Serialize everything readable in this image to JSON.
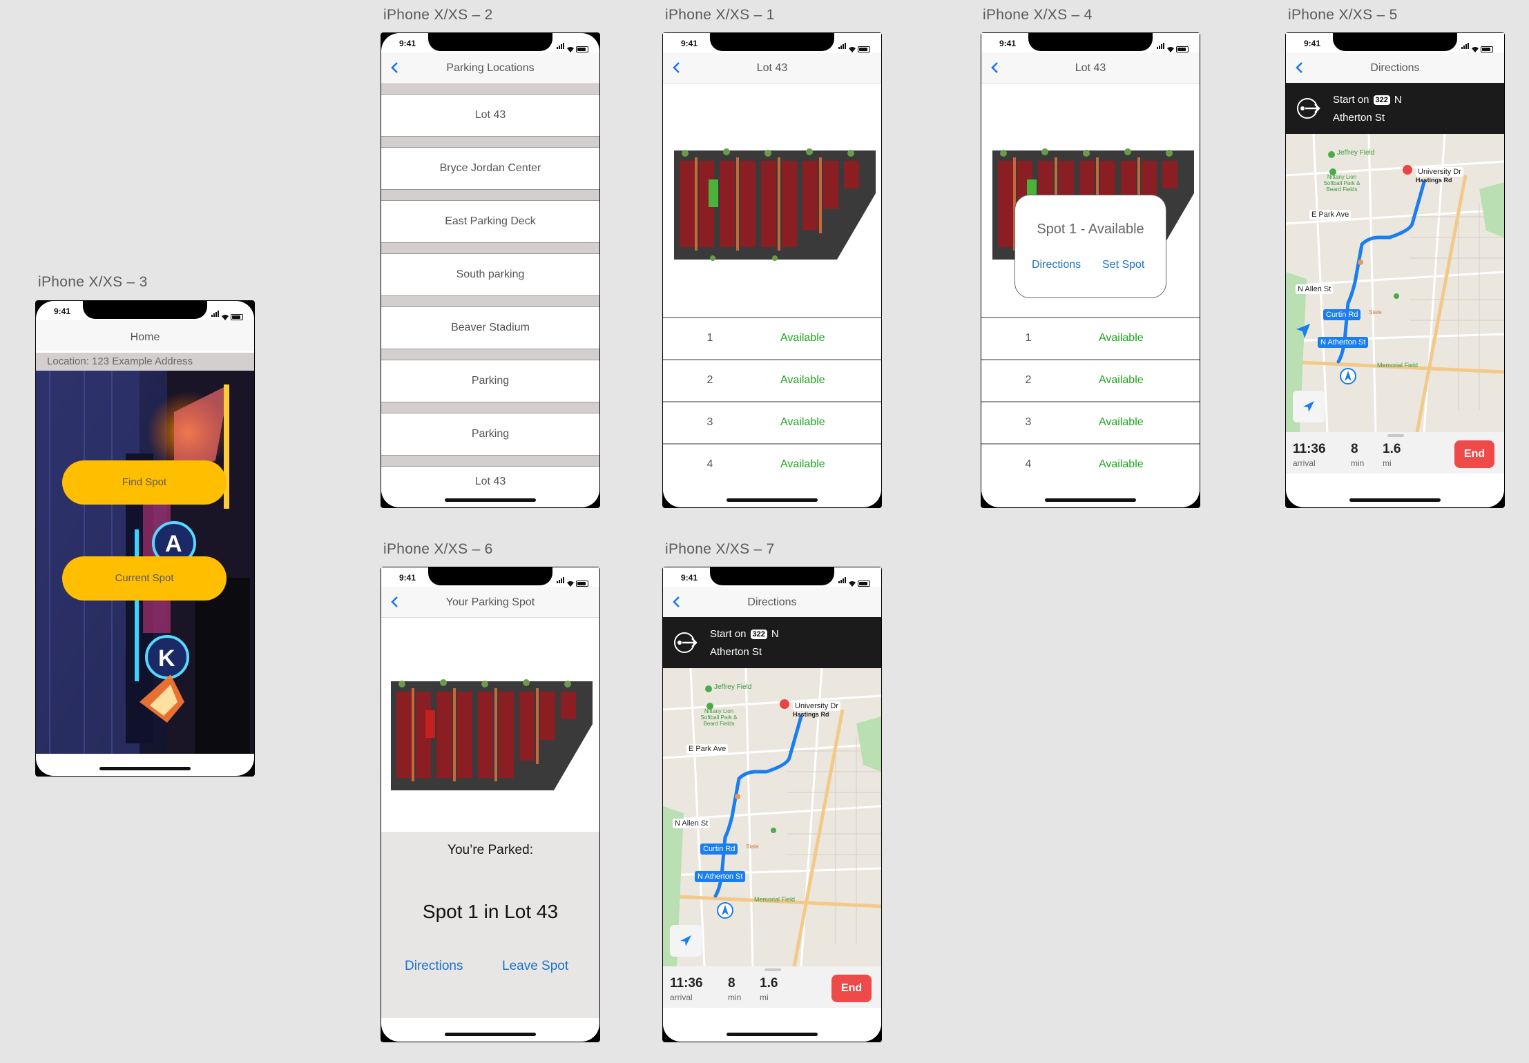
{
  "status_time": "9:41",
  "artboards": {
    "a3": "iPhone X/XS – 3",
    "a2": "iPhone X/XS – 2",
    "a1": "iPhone X/XS – 1",
    "a4": "iPhone X/XS – 4",
    "a5": "iPhone X/XS – 5",
    "a6": "iPhone X/XS – 6",
    "a7": "iPhone X/XS – 7"
  },
  "home": {
    "title": "Home",
    "location": "Location: 123 Example Address",
    "find_spot": "Find Spot",
    "current_spot": "Current Spot",
    "accent": "#ffbe00"
  },
  "parking_locations": {
    "title": "Parking Locations",
    "items": [
      "Lot 43",
      "Bryce Jordan Center",
      "East Parking Deck",
      "South parking",
      "Beaver Stadium",
      "Parking",
      "Parking",
      "Lot 43"
    ]
  },
  "lot": {
    "title": "Lot 43",
    "spots": [
      {
        "num": "1",
        "status": "Available"
      },
      {
        "num": "2",
        "status": "Available"
      },
      {
        "num": "3",
        "status": "Available"
      },
      {
        "num": "4",
        "status": "Available"
      }
    ],
    "status_color": "#19a619"
  },
  "popup": {
    "title": "Spot 1 - Available",
    "directions": "Directions",
    "set_spot": "Set Spot"
  },
  "directions": {
    "title": "Directions",
    "start_on": "Start on",
    "route": "322",
    "dir": "N",
    "street": "Atherton St",
    "arrival_val": "11:36",
    "arrival_lbl": "arrival",
    "min_val": "8",
    "min_lbl": "min",
    "mi_val": "1.6",
    "mi_lbl": "mi",
    "end": "End",
    "map_labels": {
      "jeffrey": "Jeffrey Field",
      "nittany": "Nittany Lion Softball Park & Beard Fields",
      "university": "University Dr",
      "hastings": "Hastings Rd",
      "epark": "E Park Ave",
      "nallen": "N Allen St",
      "curtin": "Curtin Rd",
      "natherton": "N Atherton St",
      "state": "State",
      "memorial": "Memorial Field"
    }
  },
  "your_spot": {
    "title": "Your Parking Spot",
    "parked": "You’re Parked:",
    "spot": "Spot 1 in Lot 43",
    "directions": "Directions",
    "leave": "Leave Spot"
  }
}
